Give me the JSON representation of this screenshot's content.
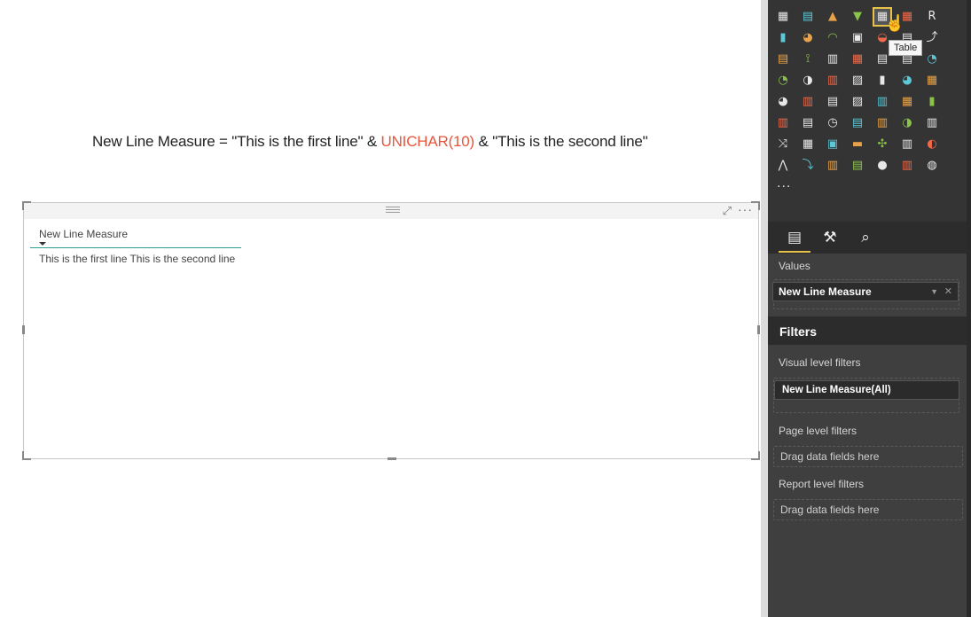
{
  "formula": {
    "prefix": "New Line Measure = \"This is the first line\" & ",
    "function": "UNICHAR(10)",
    "suffix": " & \"This is the second line\""
  },
  "table_visual": {
    "column_header": "New Line Measure",
    "cell_value": "This is the first line This is the second line"
  },
  "viz_gallery": {
    "tooltip": "Table",
    "more": "..."
  },
  "tabs": {
    "fields_icon": "fields-icon",
    "format_icon": "paint-roller-icon",
    "analytics_icon": "analytics-icon"
  },
  "values": {
    "label": "Values",
    "field": "New Line Measure"
  },
  "filters": {
    "title": "Filters",
    "visual_level_label": "Visual level filters",
    "visual_level_filter": "New Line Measure(All)",
    "page_level_label": "Page level filters",
    "page_level_drop": "Drag data fields here",
    "report_level_label": "Report level filters",
    "report_level_drop": "Drag data fields here"
  },
  "colors": {
    "accent": "#e6c24a",
    "function_text": "#e8553a",
    "header_underline": "#2d9f8f",
    "panel_bg": "#3f3f3f"
  }
}
